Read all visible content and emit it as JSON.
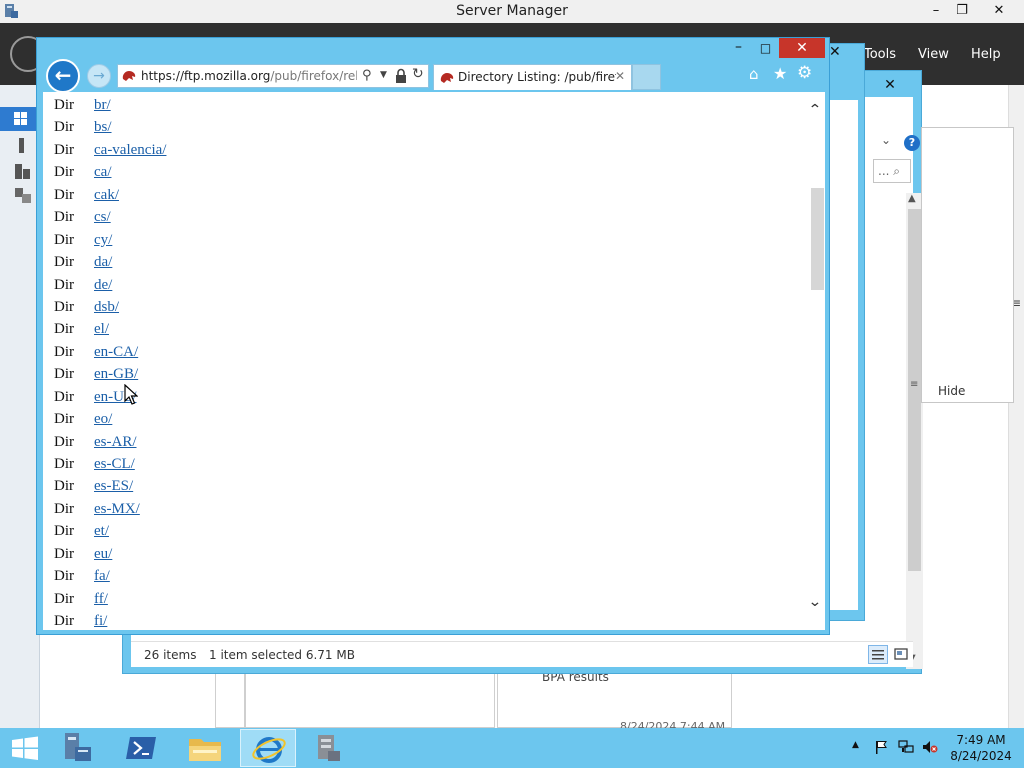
{
  "server_manager": {
    "title": "Server Manager",
    "menu": [
      "Tools",
      "View",
      "Help"
    ],
    "min_icon": "minimize-icon",
    "max_icon": "restore-icon",
    "close_icon": "close-icon",
    "tile_bpa": "BPA results",
    "tile_bpa_date": "8/24/2024 7:44 AM"
  },
  "explorer": {
    "status_items": "26 items",
    "status_selected": "1 item selected  6.71 MB",
    "hide_label": "Hide",
    "search_placeholder": "... ⌕",
    "help_glyph": "?"
  },
  "ie": {
    "url_host_prefix": "https://ftp.",
    "url_host": "mozilla.org",
    "url_path": "/pub/firefox/releas",
    "tab_title": "Directory Listing: /pub/firef...",
    "tab_close": "✕",
    "accent": "#6cc6ee",
    "link_color": "#1b5fa8",
    "listing": [
      {
        "type": "Dir",
        "name": "br/"
      },
      {
        "type": "Dir",
        "name": "bs/"
      },
      {
        "type": "Dir",
        "name": "ca-valencia/"
      },
      {
        "type": "Dir",
        "name": "ca/"
      },
      {
        "type": "Dir",
        "name": "cak/"
      },
      {
        "type": "Dir",
        "name": "cs/"
      },
      {
        "type": "Dir",
        "name": "cy/"
      },
      {
        "type": "Dir",
        "name": "da/"
      },
      {
        "type": "Dir",
        "name": "de/"
      },
      {
        "type": "Dir",
        "name": "dsb/"
      },
      {
        "type": "Dir",
        "name": "el/"
      },
      {
        "type": "Dir",
        "name": "en-CA/"
      },
      {
        "type": "Dir",
        "name": "en-GB/"
      },
      {
        "type": "Dir",
        "name": "en-US/"
      },
      {
        "type": "Dir",
        "name": "eo/"
      },
      {
        "type": "Dir",
        "name": "es-AR/"
      },
      {
        "type": "Dir",
        "name": "es-CL/"
      },
      {
        "type": "Dir",
        "name": "es-ES/"
      },
      {
        "type": "Dir",
        "name": "es-MX/"
      },
      {
        "type": "Dir",
        "name": "et/"
      },
      {
        "type": "Dir",
        "name": "eu/"
      },
      {
        "type": "Dir",
        "name": "fa/"
      },
      {
        "type": "Dir",
        "name": "ff/"
      },
      {
        "type": "Dir",
        "name": "fi/"
      }
    ]
  },
  "taskbar": {
    "pinned": [
      "server-manager-icon",
      "powershell-icon",
      "file-explorer-icon",
      "internet-explorer-icon",
      "admin-tool-icon"
    ],
    "time": "7:49 AM",
    "date": "8/24/2024"
  }
}
